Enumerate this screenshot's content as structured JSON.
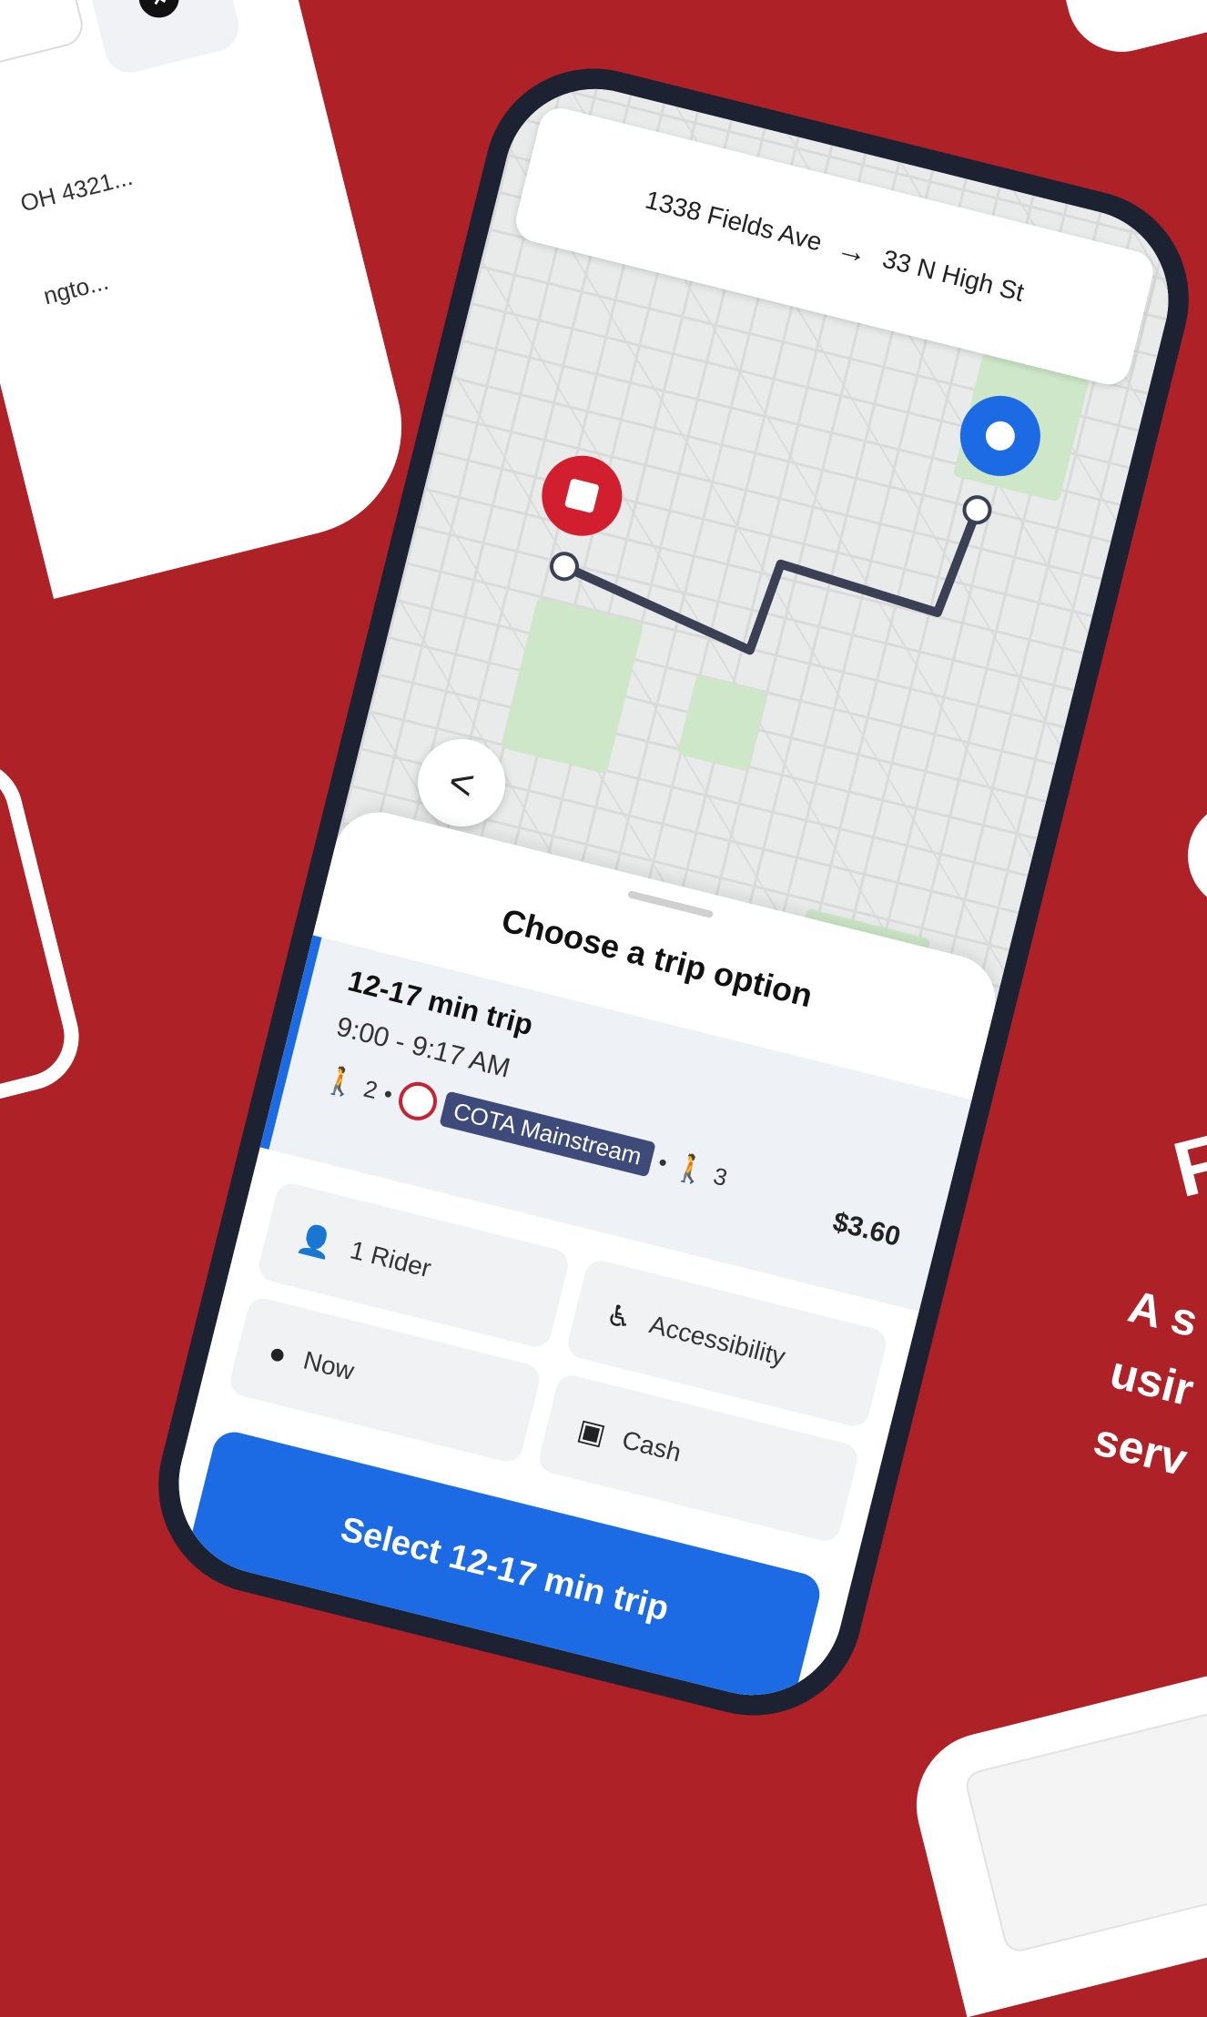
{
  "route_bar": {
    "origin": "1338 Fields Ave",
    "arrow": "→",
    "destination": "33 N High St"
  },
  "back_button": {
    "label": "<"
  },
  "sheet": {
    "title": "Choose a trip option",
    "trip": {
      "duration": "12-17 min trip",
      "times": "9:00 - 9:17 AM",
      "walk_before": "2",
      "service": "COTA Mainstream",
      "walk_after": "3",
      "price": "$3.60"
    },
    "options": {
      "riders": "1 Rider",
      "time": "Now",
      "accessibility": "Accessibility",
      "payment": "Cash"
    },
    "select_button": "Select 12-17 min trip"
  },
  "background": {
    "address_1": "OH 4321...",
    "address_2": "ngto..."
  },
  "promo": {
    "heading": "F",
    "line_1": "A s",
    "line_2": "usir",
    "line_3": "serv"
  },
  "colors": {
    "background": "#ad2127",
    "accent_blue": "#1c6be4",
    "origin_pin": "#d21f2f",
    "destination_pin": "#1c6be4",
    "route_line": "#3b4054"
  },
  "icons": [
    "close-icon",
    "arrow-right-icon",
    "back-chevron-icon",
    "walk-icon",
    "bus-icon",
    "person-icon",
    "clock-icon",
    "wheelchair-icon",
    "cash-icon"
  ]
}
